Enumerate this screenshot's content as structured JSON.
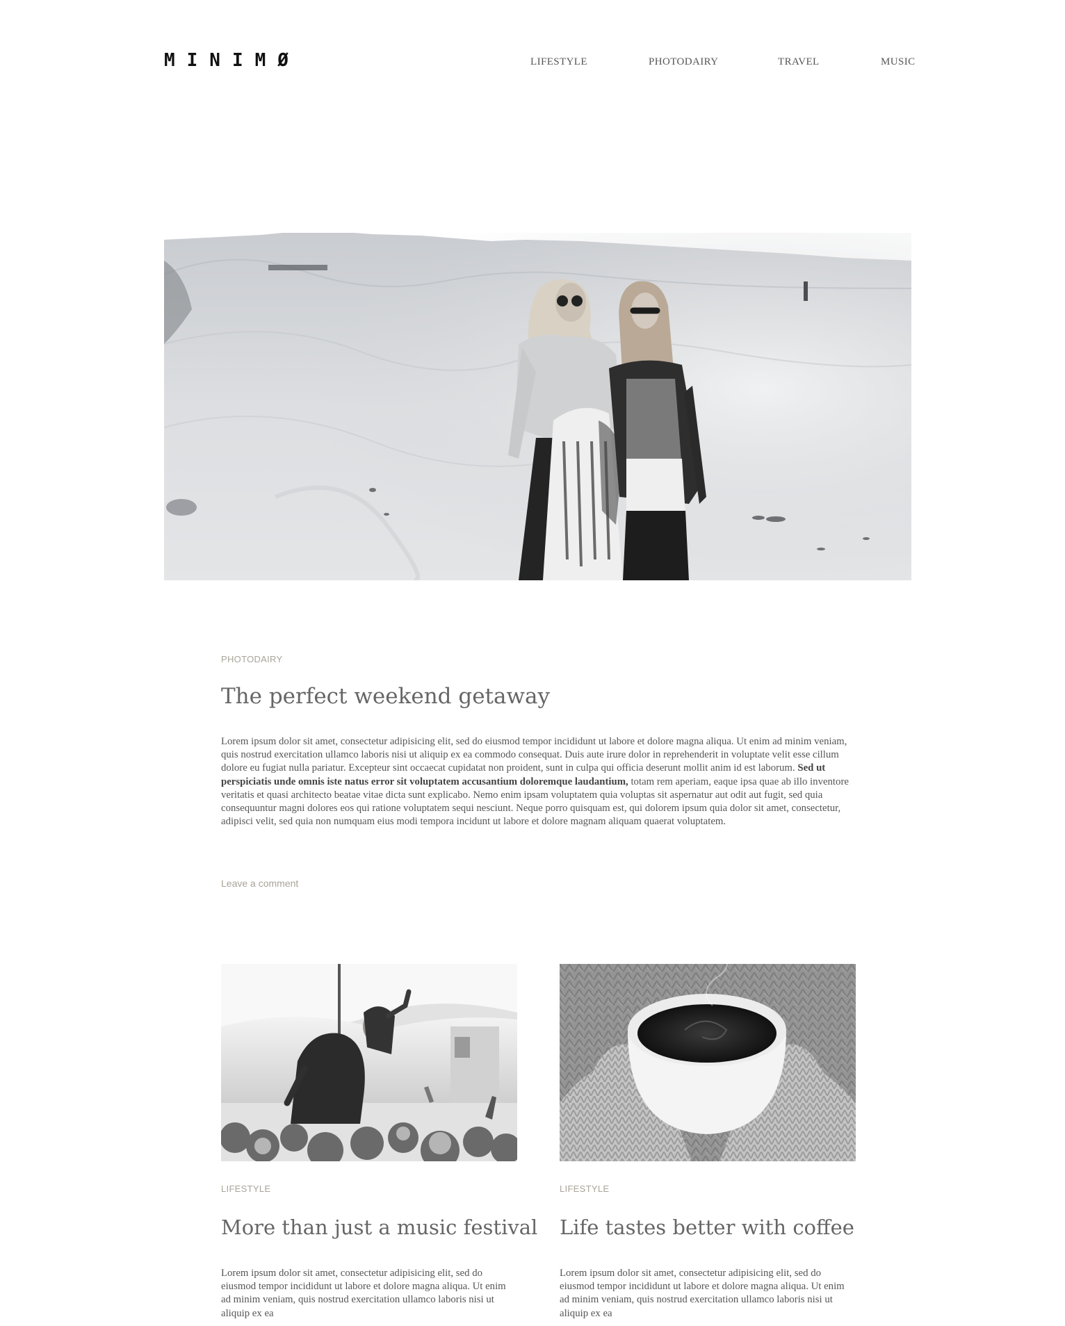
{
  "header": {
    "logo": "MINIMØ",
    "nav": [
      "LIFESTYLE",
      "PHOTODAIRY",
      "TRAVEL",
      "MUSIC"
    ]
  },
  "featured": {
    "category": "PHOTODAIRY",
    "title": "The perfect weekend getaway",
    "body_before_bold": "Lorem ipsum dolor sit amet, consectetur adipisicing elit, sed do eiusmod tempor incididunt ut labore et dolore magna aliqua. Ut enim ad minim veniam, quis nostrud exercitation ullamco laboris nisi ut aliquip ex ea commodo consequat. Duis aute irure dolor in reprehenderit in voluptate velit esse cillum dolore eu fugiat nulla pariatur. Excepteur sint occaecat cupidatat non proident, sunt in culpa qui officia deserunt mollit anim id est laborum. ",
    "body_bold": "Sed ut perspiciatis unde omnis iste natus error sit voluptatem accusantium doloremque laudantium,",
    "body_after_bold": " totam rem aperiam, eaque ipsa quae ab illo inventore veritatis et quasi architecto beatae vitae dicta sunt explicabo. Nemo enim ipsam voluptatem quia voluptas sit aspernatur aut odit aut fugit, sed quia consequuntur magni dolores eos qui ratione voluptatem sequi nesciunt. Neque porro quisquam est, qui dolorem ipsum quia dolor sit amet, consectetur, adipisci velit, sed quia non numquam eius modi tempora incidunt ut labore et dolore magnam aliquam quaerat voluptatem.",
    "comment_link": "Leave a comment"
  },
  "cards": [
    {
      "category": "LIFESTYLE",
      "title": "More than just a music festival",
      "body": "Lorem ipsum dolor sit amet, consectetur adipisicing elit, sed do eiusmod tempor incididunt ut labore et dolore magna aliqua. Ut enim ad minim veniam, quis nostrud exercitation ullamco laboris nisi ut aliquip ex ea"
    },
    {
      "category": "LIFESTYLE",
      "title": "Life tastes better with coffee",
      "body": "Lorem ipsum dolor sit amet, consectetur adipisicing elit, sed do eiusmod tempor incididunt ut labore et dolore magna aliqua. Ut enim ad minim veniam, quis nostrud exercitation ullamco laboris nisi ut aliquip ex ea"
    }
  ]
}
